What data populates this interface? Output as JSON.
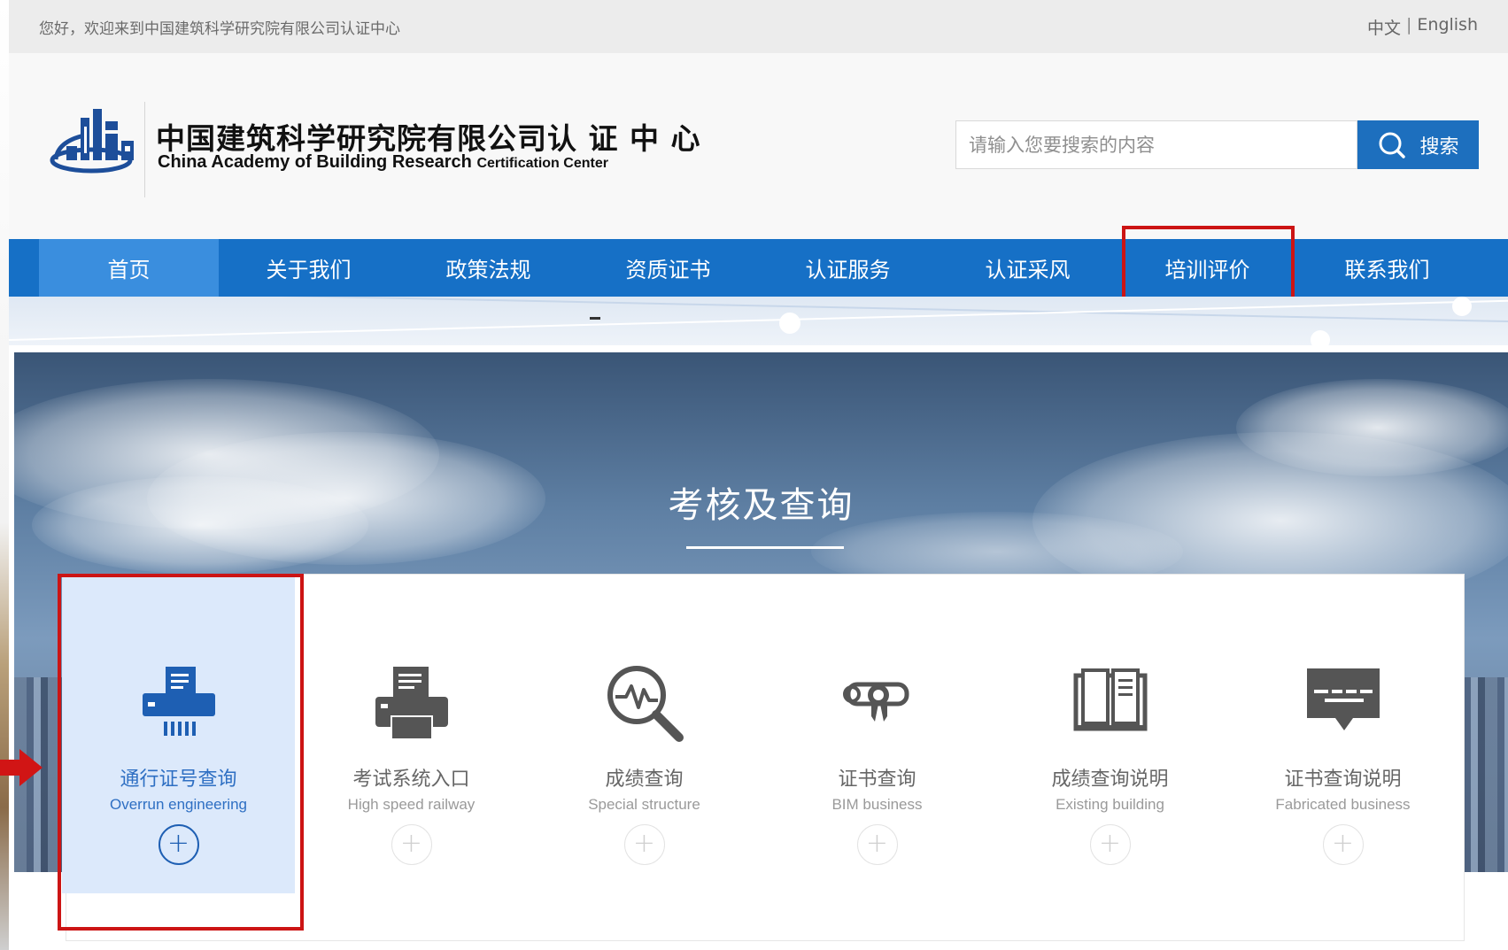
{
  "topbar": {
    "welcome": "您好，欢迎来到中国建筑科学研究院有限公司认证中心",
    "lang_cn": "中文",
    "lang_sep": "|",
    "lang_en": "English"
  },
  "header": {
    "logo_cn": "中国建筑科学研究院有限公司认 证 中 心",
    "logo_en_main": "China Academy of Building Research",
    "logo_en_sub": "Certification Center",
    "search_placeholder": "请输入您要搜索的内容",
    "search_button": "搜索"
  },
  "nav": {
    "items": [
      {
        "label": "首页"
      },
      {
        "label": "关于我们"
      },
      {
        "label": "政策法规"
      },
      {
        "label": "资质证书"
      },
      {
        "label": "认证服务"
      },
      {
        "label": "认证采风"
      },
      {
        "label": "培训评价"
      },
      {
        "label": "联系我们"
      }
    ],
    "active_index": 0,
    "highlighted_index": 6
  },
  "hero": {
    "title": "考核及查询"
  },
  "cards": [
    {
      "title": "通行证号查询",
      "subtitle": "Overrun engineering",
      "icon": "shredder-document-icon",
      "active": true
    },
    {
      "title": "考试系统入口",
      "subtitle": "High speed railway",
      "icon": "printer-icon",
      "active": false
    },
    {
      "title": "成绩查询",
      "subtitle": "Special structure",
      "icon": "magnifier-pulse-icon",
      "active": false
    },
    {
      "title": "证书查询",
      "subtitle": "BIM business",
      "icon": "diploma-ribbon-icon",
      "active": false
    },
    {
      "title": "成绩查询说明",
      "subtitle": "Existing building",
      "icon": "book-icon",
      "active": false
    },
    {
      "title": "证书查询说明",
      "subtitle": "Fabricated business",
      "icon": "speech-bubble-icon",
      "active": false
    }
  ],
  "colors": {
    "nav_bg": "#1670c6",
    "nav_active": "#3a8ede",
    "search_button": "#1d6fbe",
    "highlight_red": "#cc1414",
    "active_card_bg": "#dce9fb",
    "active_icon": "#1e5fb3",
    "inactive_icon": "#555555"
  }
}
